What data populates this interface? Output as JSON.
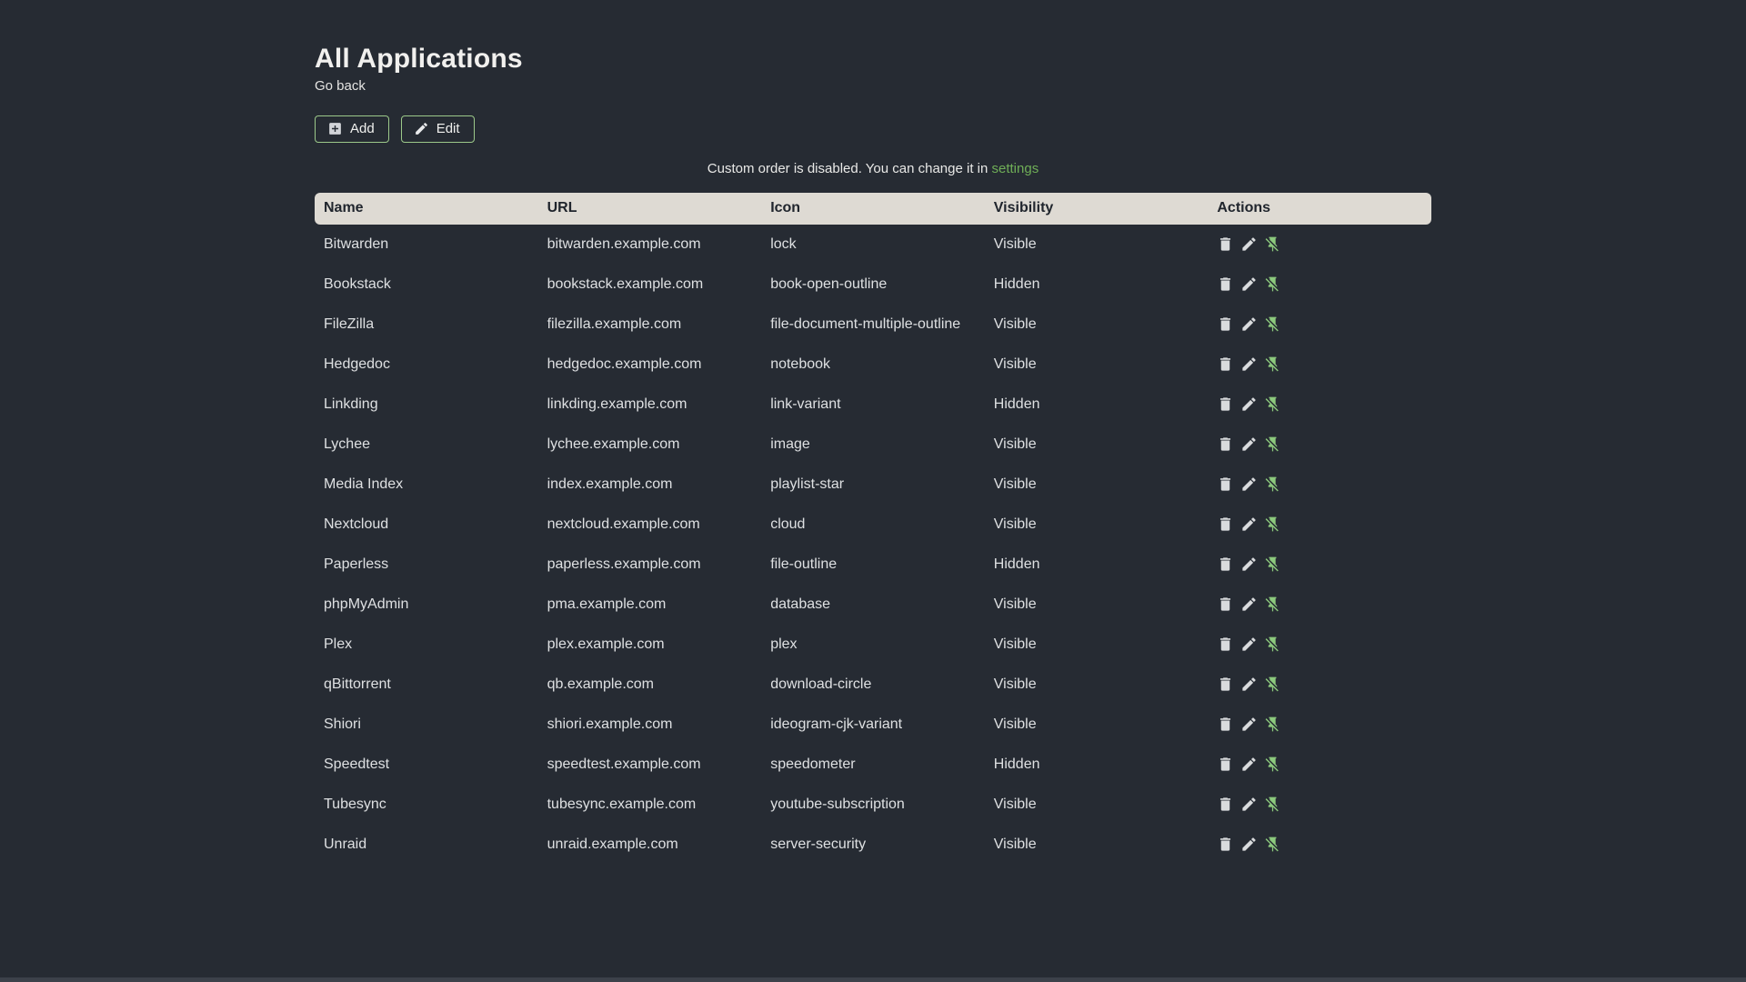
{
  "page": {
    "title": "All Applications",
    "back_link": "Go back",
    "buttons": {
      "add": "Add",
      "edit": "Edit"
    },
    "notice": {
      "text": "Custom order is disabled. You can change it in ",
      "link": "settings"
    }
  },
  "table": {
    "headers": [
      "Name",
      "URL",
      "Icon",
      "Visibility",
      "Actions"
    ],
    "action_icons": [
      "delete",
      "edit",
      "pin-off"
    ],
    "rows": [
      {
        "name": "Bitwarden",
        "url": "bitwarden.example.com",
        "icon": "lock",
        "visibility": "Visible"
      },
      {
        "name": "Bookstack",
        "url": "bookstack.example.com",
        "icon": "book-open-outline",
        "visibility": "Hidden"
      },
      {
        "name": "FileZilla",
        "url": "filezilla.example.com",
        "icon": "file-document-multiple-outline",
        "visibility": "Visible"
      },
      {
        "name": "Hedgedoc",
        "url": "hedgedoc.example.com",
        "icon": "notebook",
        "visibility": "Visible"
      },
      {
        "name": "Linkding",
        "url": "linkding.example.com",
        "icon": "link-variant",
        "visibility": "Hidden"
      },
      {
        "name": "Lychee",
        "url": "lychee.example.com",
        "icon": "image",
        "visibility": "Visible"
      },
      {
        "name": "Media Index",
        "url": "index.example.com",
        "icon": "playlist-star",
        "visibility": "Visible"
      },
      {
        "name": "Nextcloud",
        "url": "nextcloud.example.com",
        "icon": "cloud",
        "visibility": "Visible"
      },
      {
        "name": "Paperless",
        "url": "paperless.example.com",
        "icon": "file-outline",
        "visibility": "Hidden"
      },
      {
        "name": "phpMyAdmin",
        "url": "pma.example.com",
        "icon": "database",
        "visibility": "Visible"
      },
      {
        "name": "Plex",
        "url": "plex.example.com",
        "icon": "plex",
        "visibility": "Visible"
      },
      {
        "name": "qBittorrent",
        "url": "qb.example.com",
        "icon": "download-circle",
        "visibility": "Visible"
      },
      {
        "name": "Shiori",
        "url": "shiori.example.com",
        "icon": "ideogram-cjk-variant",
        "visibility": "Visible"
      },
      {
        "name": "Speedtest",
        "url": "speedtest.example.com",
        "icon": "speedometer",
        "visibility": "Hidden"
      },
      {
        "name": "Tubesync",
        "url": "tubesync.example.com",
        "icon": "youtube-subscription",
        "visibility": "Visible"
      },
      {
        "name": "Unraid",
        "url": "unraid.example.com",
        "icon": "server-security",
        "visibility": "Visible"
      }
    ]
  },
  "colors": {
    "background": "#262b33",
    "header_bg": "#dedad3",
    "header_text": "#20252d",
    "body_text": "#dee0e2",
    "accent_green_link": "#6fae57",
    "accent_green_pin": "#8cc97d",
    "button_border_green": "#9cc98a"
  }
}
